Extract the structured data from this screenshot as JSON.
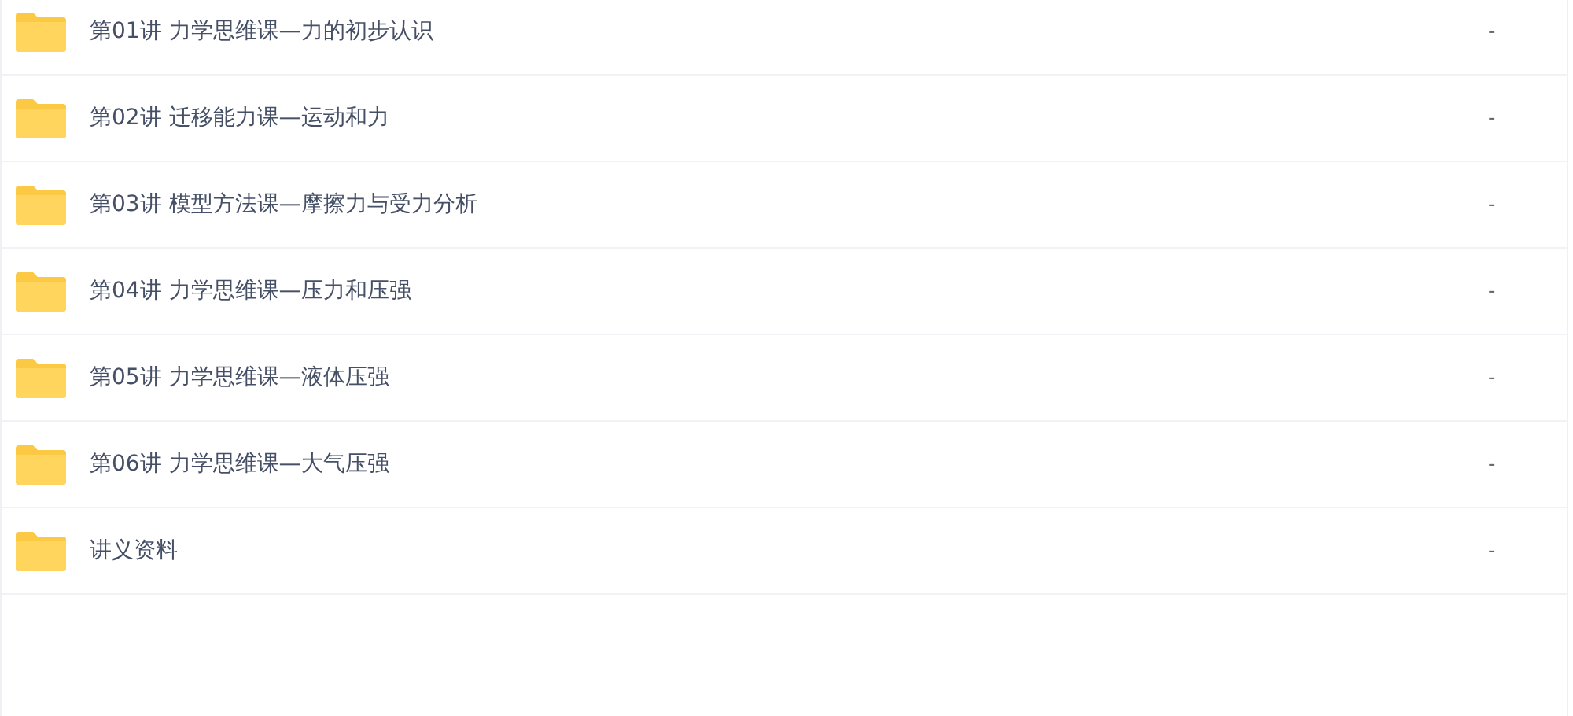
{
  "files": [
    {
      "name": "第01讲 力学思维课—力的初步认识",
      "size": "-"
    },
    {
      "name": "第02讲 迁移能力课—运动和力",
      "size": "-"
    },
    {
      "name": "第03讲 模型方法课—摩擦力与受力分析",
      "size": "-"
    },
    {
      "name": "第04讲 力学思维课—压力和压强",
      "size": "-"
    },
    {
      "name": "第05讲 力学思维课—液体压强",
      "size": "-"
    },
    {
      "name": "第06讲 力学思维课—大气压强",
      "size": "-"
    },
    {
      "name": "讲义资料",
      "size": "-"
    }
  ]
}
